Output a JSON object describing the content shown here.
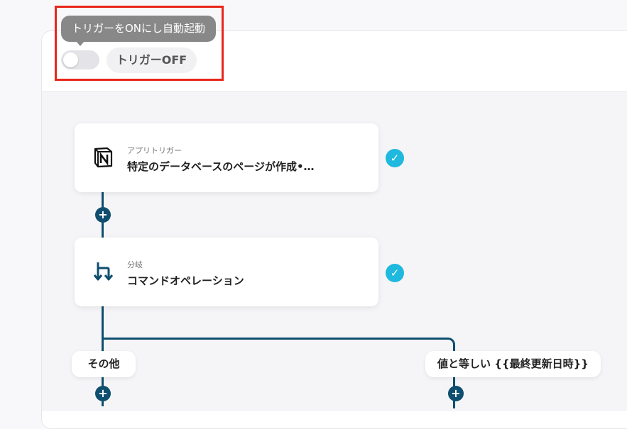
{
  "trigger": {
    "tooltip": "トリガーをONにし自動起動",
    "status_label": "トリガーOFF",
    "enabled": false
  },
  "nodes": [
    {
      "subtitle": "アプリトリガー",
      "title": "特定のデータベースのページが作成•…",
      "icon": "notion-icon",
      "status": "completed"
    },
    {
      "subtitle": "分岐",
      "title": "コマンドオペレーション",
      "icon": "branch-icon",
      "status": "completed"
    }
  ],
  "branches": [
    {
      "label": "その他"
    },
    {
      "label": "値と等しい {{最終更新日時}}"
    }
  ],
  "colors": {
    "accent": "#0f4e6e",
    "check": "#1fb8de",
    "highlight": "#e8261a"
  }
}
